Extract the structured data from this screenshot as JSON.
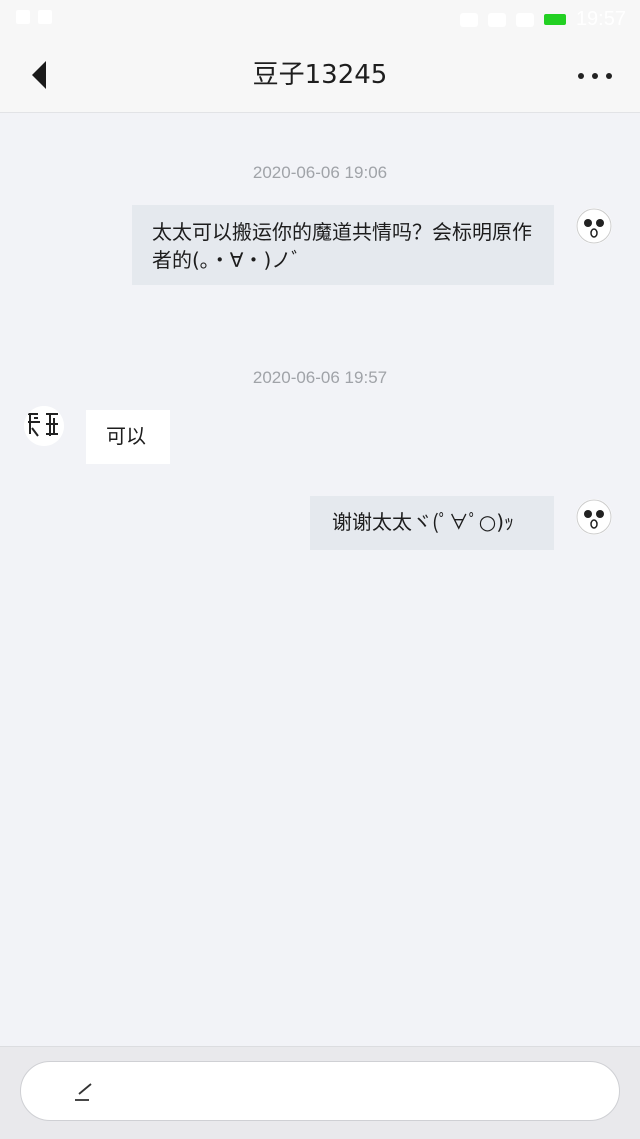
{
  "status_bar": {
    "time": "19:57",
    "battery_color": "#22d022"
  },
  "header": {
    "title": "豆子13245",
    "back_icon": "chevron-left-icon",
    "more_icon": "more-dots-icon"
  },
  "messages": [
    {
      "timestamp": "2020-06-06 19:06",
      "direction": "outgoing",
      "text": "太太可以搬运你的魔道共情吗？会标明原作者的(｡・∀・)ノﾞ"
    },
    {
      "timestamp": "2020-06-06 19:57",
      "direction": "incoming",
      "text": "可以"
    },
    {
      "direction": "outgoing",
      "text": "谢谢太太ヾ(ﾟ∀ﾟ○)ｯ"
    }
  ],
  "composer": {
    "icon": "pen-icon",
    "value": ""
  },
  "colors": {
    "background": "#f2f3f7",
    "outgoing_bubble": "#e5e9ee",
    "incoming_bubble": "#ffffff",
    "timestamp": "#a0a3a8"
  }
}
